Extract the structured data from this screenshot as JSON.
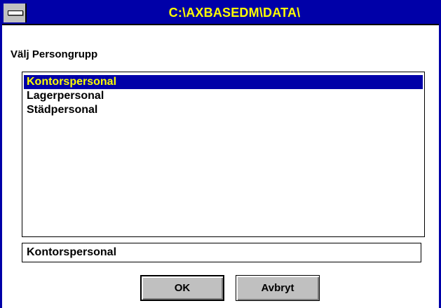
{
  "window": {
    "title": "C:\\AXBASEDM\\DATA\\"
  },
  "dialog": {
    "prompt": "Välj Persongrupp",
    "list_items": [
      {
        "label": "Kontorspersonal",
        "selected": true
      },
      {
        "label": "Lagerpersonal",
        "selected": false
      },
      {
        "label": "Städpersonal",
        "selected": false
      }
    ],
    "selection_value": "Kontorspersonal",
    "ok_label": "OK",
    "cancel_label": "Avbryt"
  },
  "colors": {
    "title_background": "#0000a8",
    "title_text": "#ffff00",
    "selection_background": "#0000a8",
    "selection_text": "#ffff00",
    "button_face": "#c0c0c0"
  },
  "icons": {
    "system_menu": "system-menu-icon"
  }
}
